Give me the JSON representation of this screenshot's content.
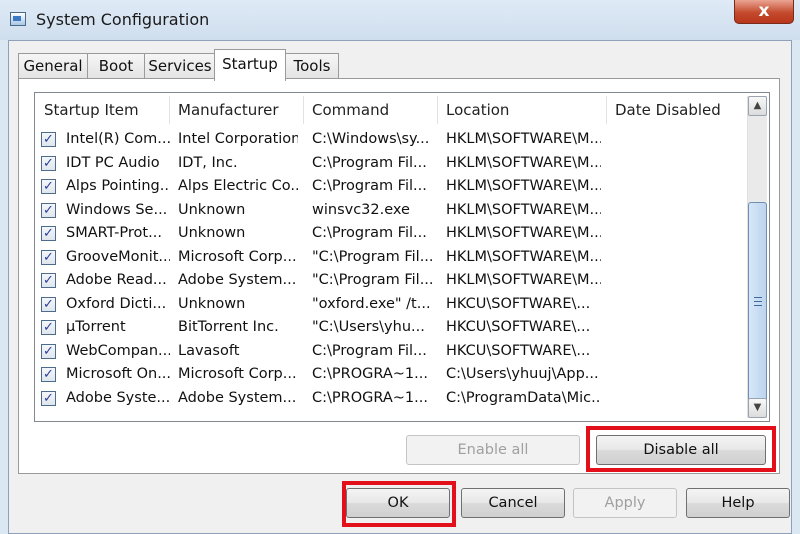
{
  "window": {
    "title": "System Configuration",
    "close_glyph": "x"
  },
  "tabs": [
    {
      "label": "General"
    },
    {
      "label": "Boot"
    },
    {
      "label": "Services"
    },
    {
      "label": "Startup",
      "active": true
    },
    {
      "label": "Tools"
    }
  ],
  "startup": {
    "columns": [
      "Startup Item",
      "Manufacturer",
      "Command",
      "Location",
      "Date Disabled"
    ],
    "rows": [
      {
        "item": "Intel(R) Com...",
        "manufacturer": "Intel Corporation",
        "command": "C:\\Windows\\sy...",
        "location": "HKLM\\SOFTWARE\\M...",
        "date_disabled": "",
        "checked": true
      },
      {
        "item": "IDT PC Audio",
        "manufacturer": "IDT, Inc.",
        "command": "C:\\Program Fil...",
        "location": "HKLM\\SOFTWARE\\M...",
        "date_disabled": "",
        "checked": true
      },
      {
        "item": "Alps Pointing...",
        "manufacturer": "Alps Electric Co...",
        "command": "C:\\Program Fil...",
        "location": "HKLM\\SOFTWARE\\M...",
        "date_disabled": "",
        "checked": true
      },
      {
        "item": "Windows Se...",
        "manufacturer": "Unknown",
        "command": "winsvc32.exe",
        "location": "HKLM\\SOFTWARE\\M...",
        "date_disabled": "",
        "checked": true
      },
      {
        "item": "SMART-Prot...",
        "manufacturer": "Unknown",
        "command": "C:\\Program Fil...",
        "location": "HKLM\\SOFTWARE\\M...",
        "date_disabled": "",
        "checked": true
      },
      {
        "item": "GrooveMonit...",
        "manufacturer": "Microsoft Corp...",
        "command": "\"C:\\Program Fil...",
        "location": "HKLM\\SOFTWARE\\M...",
        "date_disabled": "",
        "checked": true
      },
      {
        "item": "Adobe Read...",
        "manufacturer": "Adobe System...",
        "command": "\"C:\\Program Fil...",
        "location": "HKLM\\SOFTWARE\\M...",
        "date_disabled": "",
        "checked": true
      },
      {
        "item": "Oxford Dicti...",
        "manufacturer": "Unknown",
        "command": "\"oxford.exe\" /t...",
        "location": "HKCU\\SOFTWARE\\...",
        "date_disabled": "",
        "checked": true
      },
      {
        "item": "µTorrent",
        "manufacturer": "BitTorrent Inc.",
        "command": "\"C:\\Users\\yhu...",
        "location": "HKCU\\SOFTWARE\\...",
        "date_disabled": "",
        "checked": true
      },
      {
        "item": "WebCompan...",
        "manufacturer": "Lavasoft",
        "command": "C:\\Program Fil...",
        "location": "HKCU\\SOFTWARE\\...",
        "date_disabled": "",
        "checked": true
      },
      {
        "item": "Microsoft On...",
        "manufacturer": "Microsoft Corp...",
        "command": "C:\\PROGRA~1...",
        "location": "C:\\Users\\yhuuj\\App...",
        "date_disabled": "",
        "checked": true
      },
      {
        "item": "Adobe Syste...",
        "manufacturer": "Adobe System...",
        "command": "C:\\PROGRA~1...",
        "location": "C:\\ProgramData\\Mic...",
        "date_disabled": "",
        "checked": true
      }
    ],
    "enable_all": "Enable all",
    "disable_all": "Disable all"
  },
  "footer": {
    "ok": "OK",
    "cancel": "Cancel",
    "apply": "Apply",
    "help": "Help"
  },
  "colors": {
    "highlight": "#e3101c",
    "close_button": "#c44a2d",
    "checkmark": "#2b3f9b"
  }
}
